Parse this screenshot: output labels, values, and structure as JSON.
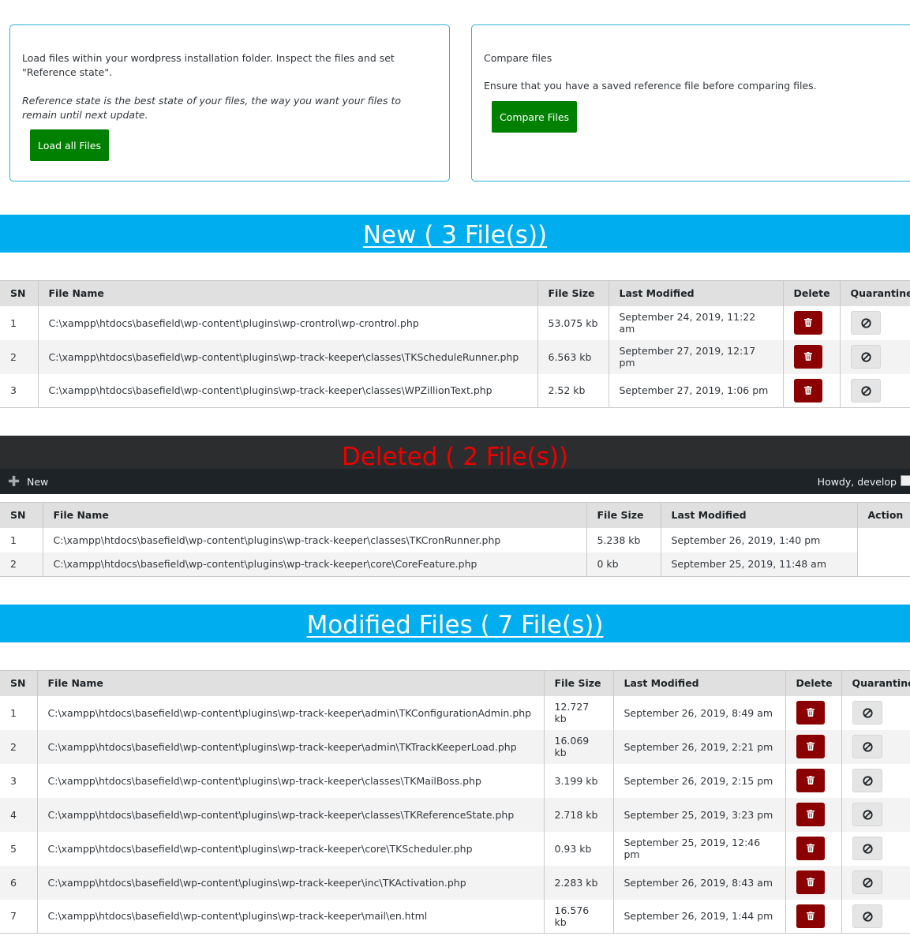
{
  "load_panel": {
    "description": "Load files within your wordpress installation folder. Inspect the files and set \"Reference state\".",
    "note": "Reference state is the best state of your files, the way you want your files to remain until next update.",
    "button_label": "Load all Files"
  },
  "compare_panel": {
    "heading": "Compare files",
    "description": "Ensure that you have a saved reference file before comparing files.",
    "button_label": "Compare Files"
  },
  "new_section": {
    "title": "New ( 3 File(s))",
    "columns": [
      "SN",
      "File Name",
      "File Size",
      "Last Modified",
      "Delete",
      "Quarantine"
    ],
    "rows": [
      {
        "sn": "1",
        "file": "C:\\xampp\\htdocs\\basefield\\wp-content\\plugins\\wp-crontrol\\wp-crontrol.php",
        "size": "53.075 kb",
        "modified": "September 24, 2019, 11:22 am"
      },
      {
        "sn": "2",
        "file": "C:\\xampp\\htdocs\\basefield\\wp-content\\plugins\\wp-track-keeper\\classes\\TKScheduleRunner.php",
        "size": "6.563 kb",
        "modified": "September 27, 2019, 12:17 pm"
      },
      {
        "sn": "3",
        "file": "C:\\xampp\\htdocs\\basefield\\wp-content\\plugins\\wp-track-keeper\\classes\\WPZillionText.php",
        "size": "2.52 kb",
        "modified": "September 27, 2019, 1:06 pm"
      }
    ]
  },
  "deleted_section": {
    "title": "Deleted ( 2 File(s))",
    "columns": [
      "SN",
      "File Name",
      "File Size",
      "Last Modified",
      "Action"
    ],
    "rows": [
      {
        "sn": "1",
        "file": "C:\\xampp\\htdocs\\basefield\\wp-content\\plugins\\wp-track-keeper\\classes\\TKCronRunner.php",
        "size": "5.238 kb",
        "modified": "September 26, 2019, 1:40 pm"
      },
      {
        "sn": "2",
        "file": "C:\\xampp\\htdocs\\basefield\\wp-content\\plugins\\wp-track-keeper\\core\\CoreFeature.php",
        "size": "0 kb",
        "modified": "September 25, 2019, 11:48 am"
      }
    ]
  },
  "admin_bar": {
    "new_label": "New",
    "greeting": "Howdy, develop",
    "plus_icon": "plus-icon"
  },
  "modified_section": {
    "title": "Modified Files ( 7 File(s))",
    "columns": [
      "SN",
      "File Name",
      "File Size",
      "Last Modified",
      "Delete",
      "Quarantine"
    ],
    "rows": [
      {
        "sn": "1",
        "file": "C:\\xampp\\htdocs\\basefield\\wp-content\\plugins\\wp-track-keeper\\admin\\TKConfigurationAdmin.php",
        "size": "12.727 kb",
        "modified": "September 26, 2019, 8:49 am"
      },
      {
        "sn": "2",
        "file": "C:\\xampp\\htdocs\\basefield\\wp-content\\plugins\\wp-track-keeper\\admin\\TKTrackKeeperLoad.php",
        "size": "16.069 kb",
        "modified": "September 26, 2019, 2:21 pm"
      },
      {
        "sn": "3",
        "file": "C:\\xampp\\htdocs\\basefield\\wp-content\\plugins\\wp-track-keeper\\classes\\TKMailBoss.php",
        "size": "3.199 kb",
        "modified": "September 26, 2019, 2:15 pm"
      },
      {
        "sn": "4",
        "file": "C:\\xampp\\htdocs\\basefield\\wp-content\\plugins\\wp-track-keeper\\classes\\TKReferenceState.php",
        "size": "2.718 kb",
        "modified": "September 25, 2019, 3:23 pm"
      },
      {
        "sn": "5",
        "file": "C:\\xampp\\htdocs\\basefield\\wp-content\\plugins\\wp-track-keeper\\core\\TKScheduler.php",
        "size": "0.93 kb",
        "modified": "September 25, 2019, 12:46 pm"
      },
      {
        "sn": "6",
        "file": "C:\\xampp\\htdocs\\basefield\\wp-content\\plugins\\wp-track-keeper\\inc\\TKActivation.php",
        "size": "2.283 kb",
        "modified": "September 26, 2019, 8:43 am"
      },
      {
        "sn": "7",
        "file": "C:\\xampp\\htdocs\\basefield\\wp-content\\plugins\\wp-track-keeper\\mail\\en.html",
        "size": "16.576 kb",
        "modified": "September 26, 2019, 1:44 pm"
      }
    ]
  },
  "icons": {
    "delete": "trash-icon",
    "quarantine": "block-icon"
  },
  "colors": {
    "accent_blue": "#00adef",
    "green": "#008000",
    "delete_red": "#8b0000",
    "deleted_title": "#ee0000",
    "admin_bar": "#1d2327"
  }
}
